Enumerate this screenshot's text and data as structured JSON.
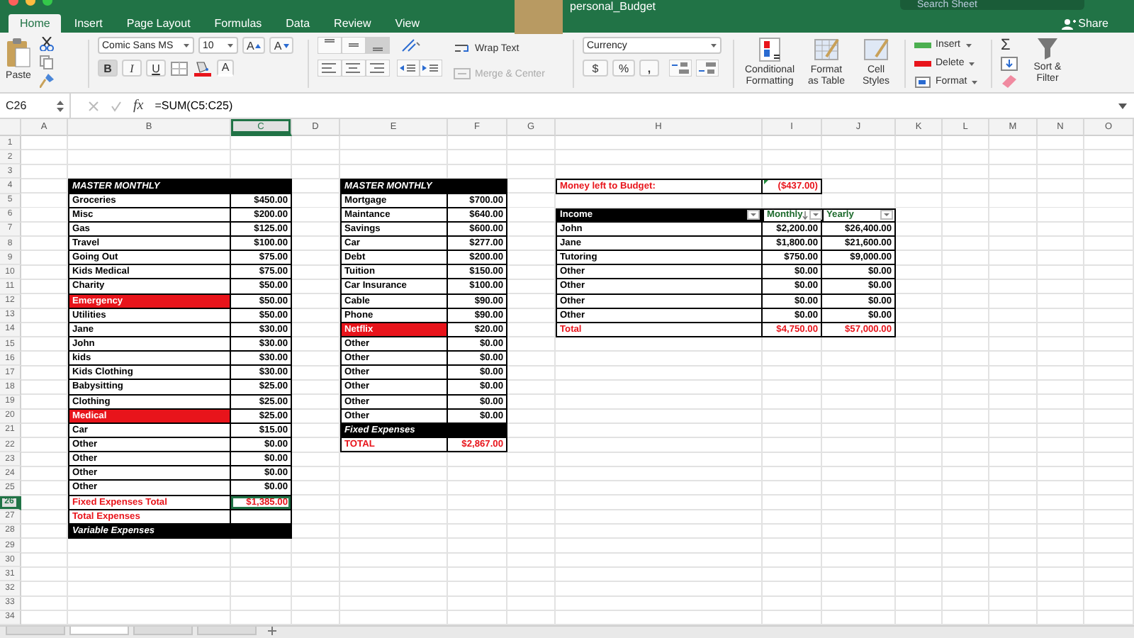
{
  "title_bar": {
    "document_title": "personal_Budget",
    "search": {
      "placeholder": "Search Sheet"
    }
  },
  "ribbon_tabs": [
    {
      "label": "Home",
      "selected": true
    },
    {
      "label": "Insert",
      "selected": false
    },
    {
      "label": "Page Layout",
      "selected": false
    },
    {
      "label": "Formulas",
      "selected": false
    },
    {
      "label": "Data",
      "selected": false
    },
    {
      "label": "Review",
      "selected": false
    },
    {
      "label": "View",
      "selected": false
    }
  ],
  "share_button": {
    "label": "Share"
  },
  "ribbon": {
    "clipboard": {
      "paste_label": "Paste"
    },
    "font": {
      "name": "Comic Sans MS",
      "size": "10",
      "grow_label": "A",
      "shrink_label": "A",
      "color_label": "A",
      "buttons": [
        {
          "kind": "bold",
          "label": "B",
          "on": true
        },
        {
          "kind": "italic",
          "label": "I",
          "on": false
        },
        {
          "kind": "underline",
          "label": "U",
          "on": false
        }
      ]
    },
    "alignment": {
      "vertical": [
        {
          "selected": false
        },
        {
          "selected": false
        },
        {
          "selected": true
        }
      ],
      "wrap_text_label": "Wrap Text",
      "merge_label": "Merge & Center",
      "merge_disabled": true
    },
    "number": {
      "format": "Currency",
      "currency_label": "$",
      "percent_label": "%",
      "comma_label": ","
    },
    "styles": [
      "Conditional Formatting",
      "Format as Table",
      "Cell Styles"
    ],
    "cells": [
      "Insert",
      "Delete",
      "Format"
    ],
    "editing": {
      "autosum_label": "Σ",
      "sort_filter_label": "Sort & Filter"
    }
  },
  "formula_bar": {
    "name_box": "C26",
    "function_label": "fx",
    "formula": "=SUM(C5:C25)",
    "editing": false
  },
  "columns": [
    {
      "label": "A",
      "selected": false
    },
    {
      "label": "B",
      "selected": false
    },
    {
      "label": "C",
      "selected": true
    },
    {
      "label": "D",
      "selected": false
    },
    {
      "label": "E",
      "selected": false
    },
    {
      "label": "F",
      "selected": false
    },
    {
      "label": "G",
      "selected": false
    },
    {
      "label": "H",
      "selected": false
    },
    {
      "label": "I",
      "selected": false
    },
    {
      "label": "J",
      "selected": false
    },
    {
      "label": "K",
      "selected": false
    },
    {
      "label": "L",
      "selected": false
    },
    {
      "label": "M",
      "selected": false
    },
    {
      "label": "N",
      "selected": false
    },
    {
      "label": "O",
      "selected": false
    }
  ],
  "rows": [
    {
      "label": "1",
      "selected": false
    },
    {
      "label": "2",
      "selected": false
    },
    {
      "label": "3",
      "selected": false
    },
    {
      "label": "4",
      "selected": false
    },
    {
      "label": "5",
      "selected": false
    },
    {
      "label": "6",
      "selected": false
    },
    {
      "label": "7",
      "selected": false
    },
    {
      "label": "8",
      "selected": false
    },
    {
      "label": "9",
      "selected": false
    },
    {
      "label": "10",
      "selected": false
    },
    {
      "label": "11",
      "selected": false
    },
    {
      "label": "12",
      "selected": false
    },
    {
      "label": "13",
      "selected": false
    },
    {
      "label": "14",
      "selected": false
    },
    {
      "label": "15",
      "selected": false
    },
    {
      "label": "16",
      "selected": false
    },
    {
      "label": "17",
      "selected": false
    },
    {
      "label": "18",
      "selected": false
    },
    {
      "label": "19",
      "selected": false
    },
    {
      "label": "20",
      "selected": false
    },
    {
      "label": "21",
      "selected": false
    },
    {
      "label": "22",
      "selected": false
    },
    {
      "label": "23",
      "selected": false
    },
    {
      "label": "24",
      "selected": false
    },
    {
      "label": "25",
      "selected": false
    },
    {
      "label": "26",
      "selected": true
    },
    {
      "label": "27",
      "selected": false
    },
    {
      "label": "28",
      "selected": false
    },
    {
      "label": "29",
      "selected": false
    },
    {
      "label": "30",
      "selected": false
    },
    {
      "label": "31",
      "selected": false
    },
    {
      "label": "32",
      "selected": false
    },
    {
      "label": "33",
      "selected": false
    },
    {
      "label": "34",
      "selected": false
    }
  ],
  "expense_tables": [
    {
      "title": "MASTER MONTHLY",
      "rows": [
        {
          "kind": "item",
          "label": "Groceries",
          "value": "$450.00",
          "highlight": false,
          "selected": false
        },
        {
          "kind": "item",
          "label": "Misc",
          "value": "$200.00",
          "highlight": false,
          "selected": false
        },
        {
          "kind": "item",
          "label": "Gas",
          "value": "$125.00",
          "highlight": false,
          "selected": false
        },
        {
          "kind": "item",
          "label": "Travel",
          "value": "$100.00",
          "highlight": false,
          "selected": false
        },
        {
          "kind": "item",
          "label": "Going Out",
          "value": "$75.00",
          "highlight": false,
          "selected": false
        },
        {
          "kind": "item",
          "label": "Kids Medical",
          "value": "$75.00",
          "highlight": false,
          "selected": false
        },
        {
          "kind": "item",
          "label": "Charity",
          "value": "$50.00",
          "highlight": false,
          "selected": false
        },
        {
          "kind": "item",
          "label": "Emergency",
          "value": "$50.00",
          "highlight": true,
          "selected": false
        },
        {
          "kind": "item",
          "label": "Utilities",
          "value": "$50.00",
          "highlight": false,
          "selected": false
        },
        {
          "kind": "item",
          "label": "Jane",
          "value": "$30.00",
          "highlight": false,
          "selected": false
        },
        {
          "kind": "item",
          "label": "John",
          "value": "$30.00",
          "highlight": false,
          "selected": false
        },
        {
          "kind": "item",
          "label": "kids",
          "value": "$30.00",
          "highlight": false,
          "selected": false
        },
        {
          "kind": "item",
          "label": "Kids Clothing",
          "value": "$30.00",
          "highlight": false,
          "selected": false
        },
        {
          "kind": "item",
          "label": "Babysitting",
          "value": "$25.00",
          "highlight": false,
          "selected": false
        },
        {
          "kind": "item",
          "label": "Clothing",
          "value": "$25.00",
          "highlight": false,
          "selected": false
        },
        {
          "kind": "item",
          "label": "Medical",
          "value": "$25.00",
          "highlight": true,
          "selected": false
        },
        {
          "kind": "item",
          "label": "Car",
          "value": "$15.00",
          "highlight": false,
          "selected": false
        },
        {
          "kind": "item",
          "label": "Other",
          "value": "$0.00",
          "highlight": false,
          "selected": false
        },
        {
          "kind": "item",
          "label": "Other",
          "value": "$0.00",
          "highlight": false,
          "selected": false
        },
        {
          "kind": "item",
          "label": "Other",
          "value": "$0.00",
          "highlight": false,
          "selected": false
        },
        {
          "kind": "item",
          "label": "Other",
          "value": "$0.00",
          "highlight": false,
          "selected": false
        },
        {
          "kind": "total",
          "label": "Fixed Expenses Total",
          "value": "$1,385.00",
          "selected": true
        },
        {
          "kind": "total",
          "label": "Total Expenses",
          "selected": false
        },
        {
          "kind": "band",
          "label": "Variable Expenses"
        }
      ]
    },
    {
      "title": "MASTER MONTHLY",
      "rows": [
        {
          "kind": "item",
          "label": "Mortgage",
          "value": "$700.00",
          "highlight": false,
          "selected": false
        },
        {
          "kind": "item",
          "label": "Maintance",
          "value": "$640.00",
          "highlight": false,
          "selected": false
        },
        {
          "kind": "item",
          "label": "Savings",
          "value": "$600.00",
          "highlight": false,
          "selected": false
        },
        {
          "kind": "item",
          "label": "Car",
          "value": "$277.00",
          "highlight": false,
          "selected": false
        },
        {
          "kind": "item",
          "label": "Debt",
          "value": "$200.00",
          "highlight": false,
          "selected": false
        },
        {
          "kind": "item",
          "label": "Tuition",
          "value": "$150.00",
          "highlight": false,
          "selected": false
        },
        {
          "kind": "item",
          "label": "Car Insurance",
          "value": "$100.00",
          "highlight": false,
          "selected": false
        },
        {
          "kind": "item",
          "label": "Cable",
          "value": "$90.00",
          "highlight": false,
          "selected": false
        },
        {
          "kind": "item",
          "label": "Phone",
          "value": "$90.00",
          "highlight": false,
          "selected": false
        },
        {
          "kind": "item",
          "label": "Netflix",
          "value": "$20.00",
          "highlight": true,
          "selected": false
        },
        {
          "kind": "item",
          "label": "Other",
          "value": "$0.00",
          "highlight": false,
          "selected": false
        },
        {
          "kind": "item",
          "label": "Other",
          "value": "$0.00",
          "highlight": false,
          "selected": false
        },
        {
          "kind": "item",
          "label": "Other",
          "value": "$0.00",
          "highlight": false,
          "selected": false
        },
        {
          "kind": "item",
          "label": "Other",
          "value": "$0.00",
          "highlight": false,
          "selected": false
        },
        {
          "kind": "item",
          "label": "Other",
          "value": "$0.00",
          "highlight": false,
          "selected": false
        },
        {
          "kind": "item",
          "label": "Other",
          "value": "$0.00",
          "highlight": false,
          "selected": false
        },
        {
          "kind": "band",
          "label": "Fixed Expenses"
        },
        {
          "kind": "total",
          "label": "TOTAL",
          "value": "$2,867.00",
          "selected": false
        }
      ]
    }
  ],
  "budget": {
    "label": "Money left to Budget:",
    "value": "($437.00)",
    "selected": false
  },
  "income_table": {
    "columns": [
      {
        "label": "Income",
        "sorted": false
      },
      {
        "label": "Monthly",
        "sorted": true
      },
      {
        "label": "Yearly",
        "sorted": false
      }
    ],
    "rows": [
      {
        "kind": "item",
        "label": "John",
        "monthly": "$2,200.00",
        "yearly": "$26,400.00"
      },
      {
        "kind": "item",
        "label": "Jane",
        "monthly": "$1,800.00",
        "yearly": "$21,600.00"
      },
      {
        "kind": "item",
        "label": "Tutoring",
        "monthly": "$750.00",
        "yearly": "$9,000.00"
      },
      {
        "kind": "item",
        "label": "Other",
        "monthly": "$0.00",
        "yearly": "$0.00"
      },
      {
        "kind": "item",
        "label": "Other",
        "monthly": "$0.00",
        "yearly": "$0.00"
      },
      {
        "kind": "item",
        "label": "Other",
        "monthly": "$0.00",
        "yearly": "$0.00"
      },
      {
        "kind": "item",
        "label": "Other",
        "monthly": "$0.00",
        "yearly": "$0.00"
      },
      {
        "kind": "total",
        "label": "Total",
        "monthly": "$4,750.00",
        "yearly": "$57,000.00"
      }
    ]
  },
  "sheet_tabs": [
    {
      "selected": false
    },
    {
      "selected": true
    },
    {
      "selected": false
    },
    {
      "selected": false
    }
  ]
}
